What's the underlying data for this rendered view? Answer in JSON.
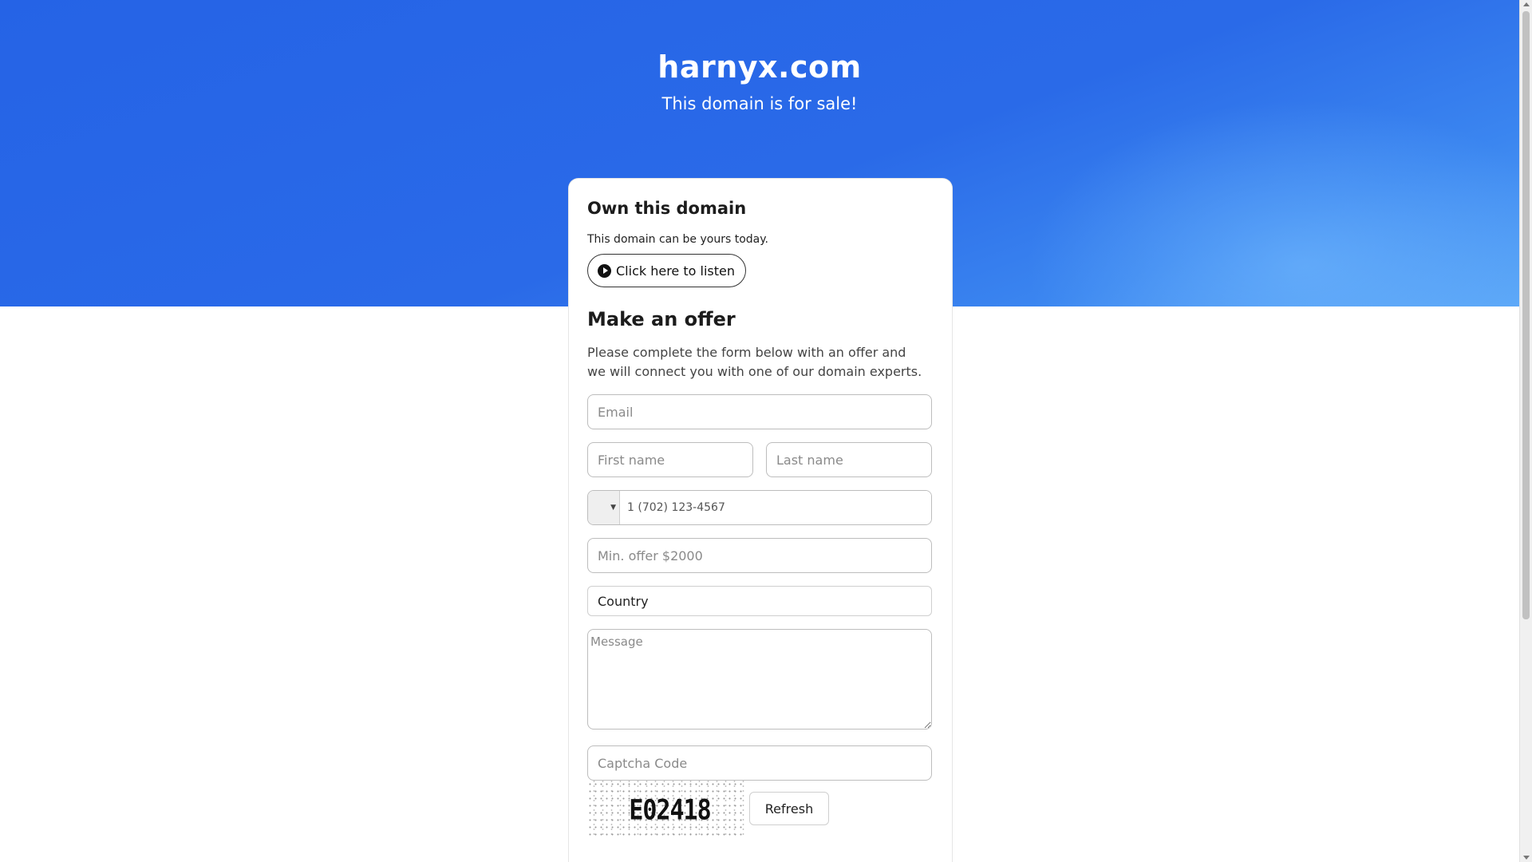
{
  "hero": {
    "domain": "harnyx.com",
    "subtitle": "This domain is for sale!"
  },
  "own_section": {
    "title": "Own this domain",
    "text": "This domain can be yours today.",
    "listen_button": "Click here to listen"
  },
  "offer_section": {
    "title": "Make an offer",
    "text": "Please complete the form below with an offer and we will connect you with one of our domain experts."
  },
  "form": {
    "email_placeholder": "Email",
    "first_name_placeholder": "First name",
    "last_name_placeholder": "Last name",
    "phone_placeholder": "1 (702) 123-4567",
    "offer_placeholder": "Min. offer $2000",
    "country_value": "Country",
    "message_placeholder": "Message",
    "captcha_placeholder": "Captcha Code",
    "captcha_code": "E02418",
    "refresh_button": "Refresh"
  },
  "icons": {
    "listen": "play-icon",
    "phone_country": "chevron-down-icon"
  },
  "colors": {
    "hero_blue": "#2563e6",
    "hero_light": "#5aa6f7"
  }
}
